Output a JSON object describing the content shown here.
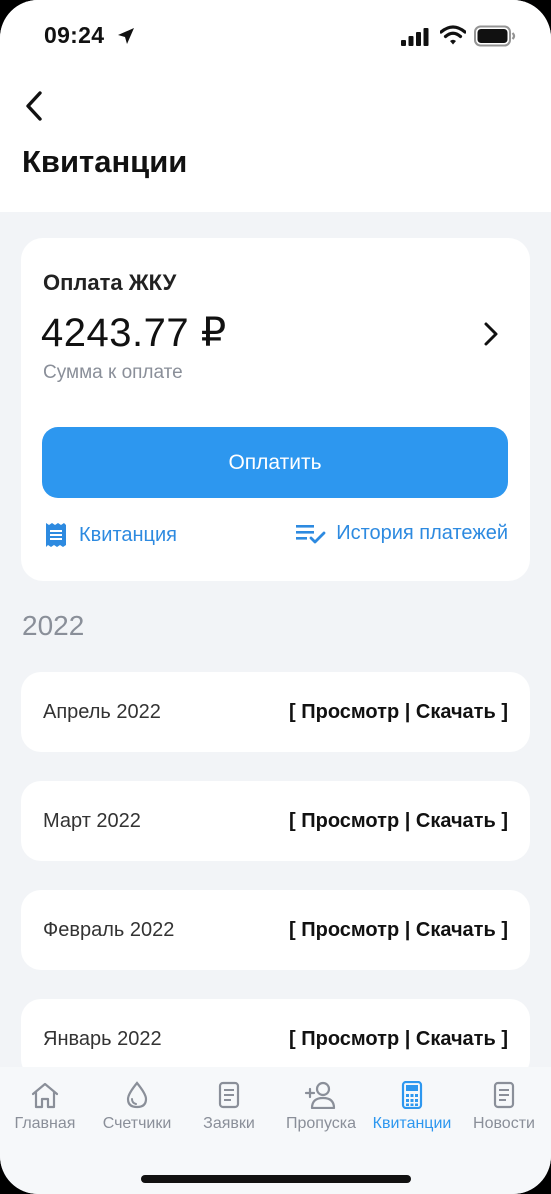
{
  "status_bar": {
    "time": "09:24"
  },
  "header": {
    "title": "Квитанции"
  },
  "payment": {
    "title": "Оплата ЖКУ",
    "amount": "4243.77 ₽",
    "amount_caption": "Сумма к оплате",
    "pay_button": "Оплатить",
    "receipt_link": "Квитанция",
    "history_link": "История платежей"
  },
  "year": "2022",
  "receipts": [
    {
      "month": "Апрель 2022",
      "actions": "[ Просмотр | Скачать ]"
    },
    {
      "month": "Март 2022",
      "actions": "[ Просмотр | Скачать ]"
    },
    {
      "month": "Февраль 2022",
      "actions": "[ Просмотр | Скачать ]"
    },
    {
      "month": "Январь 2022",
      "actions": "[ Просмотр | Скачать ]"
    }
  ],
  "tabs": [
    {
      "label": "Главная",
      "icon": "home-icon"
    },
    {
      "label": "Счетчики",
      "icon": "water-drop-icon"
    },
    {
      "label": "Заявки",
      "icon": "document-icon"
    },
    {
      "label": "Пропуска",
      "icon": "add-person-icon"
    },
    {
      "label": "Квитанции",
      "icon": "calculator-icon",
      "active": true
    },
    {
      "label": "Новости",
      "icon": "news-icon"
    }
  ],
  "colors": {
    "accent": "#2d97ef",
    "background": "#f2f4f7",
    "muted": "#8a8f99"
  }
}
